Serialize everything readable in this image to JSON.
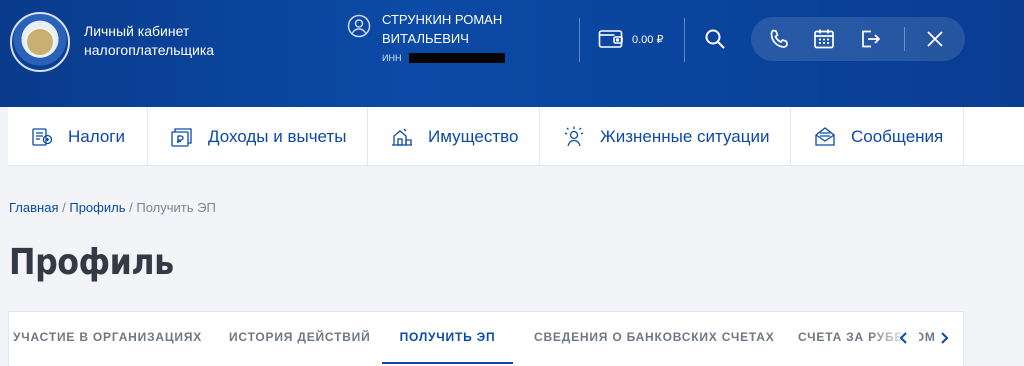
{
  "header": {
    "app_title_line1": "Личный кабинет",
    "app_title_line2": "налогоплательщика",
    "user_line1": "СТРУНКИН РОМАН",
    "user_line2": "ВИТАЛЬЕВИЧ",
    "inn_label": "ИНН",
    "balance": "0.00 ₽"
  },
  "nav": [
    {
      "label": "Налоги",
      "icon": "taxes-icon"
    },
    {
      "label": "Доходы и вычеты",
      "icon": "income-icon"
    },
    {
      "label": "Имущество",
      "icon": "property-icon"
    },
    {
      "label": "Жизненные ситуации",
      "icon": "life-situations-icon"
    },
    {
      "label": "Сообщения",
      "icon": "messages-icon"
    }
  ],
  "breadcrumb": {
    "home": "Главная",
    "sep": "/",
    "profile": "Профиль",
    "current": "Получить ЭП"
  },
  "page_title": "Профиль",
  "tabs": [
    {
      "label": "УЧАСТИЕ В ОРГАНИЗАЦИЯХ",
      "active": false
    },
    {
      "label": "ИСТОРИЯ ДЕЙСТВИЙ",
      "active": false
    },
    {
      "label": "ПОЛУЧИТЬ ЭП",
      "active": true
    },
    {
      "label": "СВЕДЕНИЯ О БАНКОВСКИХ СЧЕТАХ",
      "active": false
    },
    {
      "label": "СЧЕТА ЗА РУБЕЖОМ",
      "active": false
    }
  ],
  "colors": {
    "brand_blue": "#0b4aa6",
    "header_dark": "#0a3b8c",
    "text_dark": "#333a45"
  }
}
